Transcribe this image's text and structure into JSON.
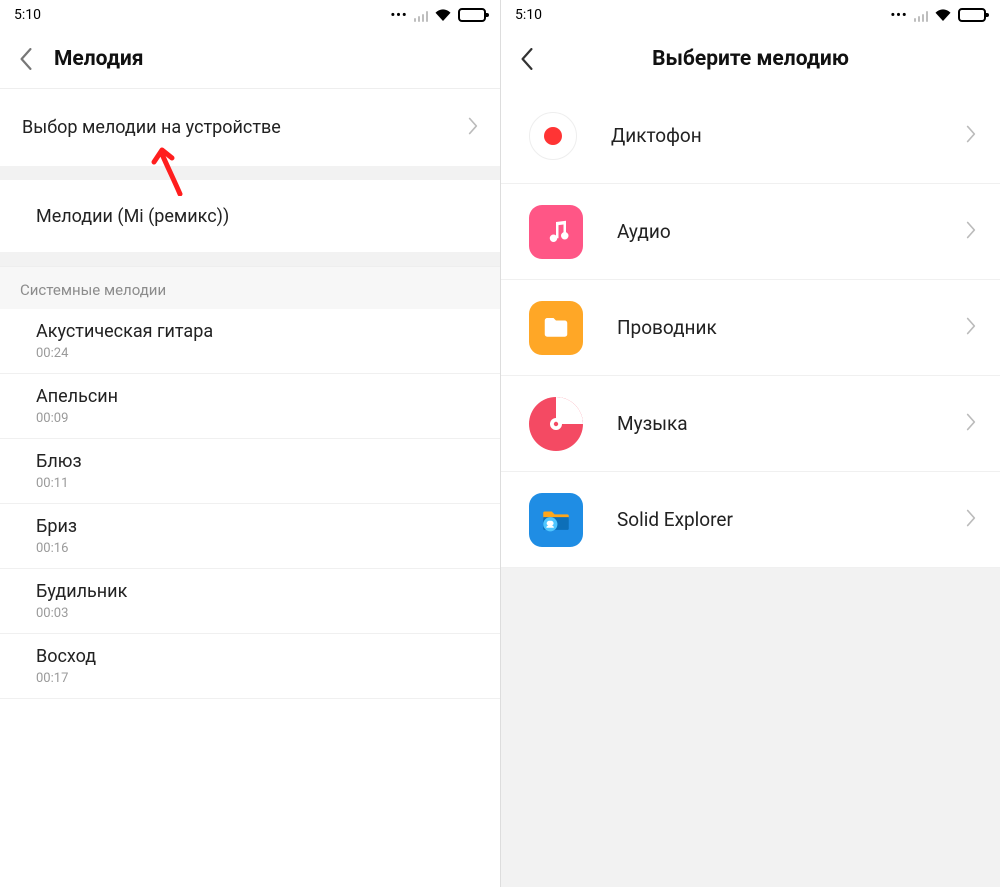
{
  "statusbar": {
    "time": "5:10"
  },
  "left": {
    "title": "Мелодия",
    "pick_on_device": "Выбор мелодии на устройстве",
    "mi_remix": "Мелодии (Mi (ремикс))",
    "section_system": "Системные мелодии",
    "songs": [
      {
        "name": "Акустическая гитара",
        "dur": "00:24"
      },
      {
        "name": "Апельсин",
        "dur": "00:09"
      },
      {
        "name": "Блюз",
        "dur": "00:11"
      },
      {
        "name": "Бриз",
        "dur": "00:16"
      },
      {
        "name": "Будильник",
        "dur": "00:03"
      },
      {
        "name": "Восход",
        "dur": "00:17"
      }
    ]
  },
  "right": {
    "title": "Выберите мелодию",
    "apps": [
      {
        "label": "Диктофон",
        "icon": "recorder"
      },
      {
        "label": "Аудио",
        "icon": "audio"
      },
      {
        "label": "Проводник",
        "icon": "files"
      },
      {
        "label": "Музыка",
        "icon": "music"
      },
      {
        "label": "Solid Explorer",
        "icon": "solid-explorer"
      }
    ]
  }
}
